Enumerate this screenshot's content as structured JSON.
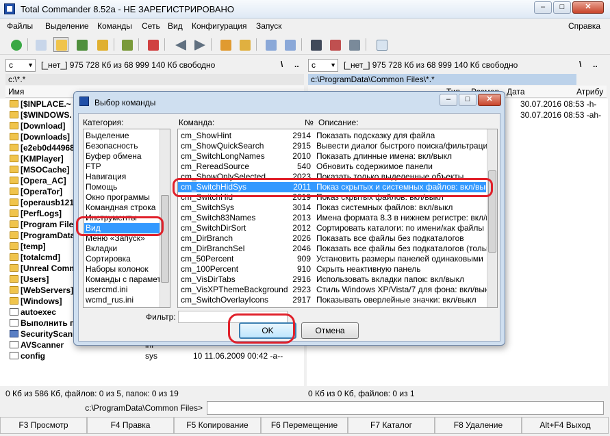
{
  "window": {
    "title": "Total Commander 8.52a - НЕ ЗАРЕГИСТРИРОВАНО",
    "btn_min": "–",
    "btn_max": "□",
    "btn_close": "✕"
  },
  "menu": {
    "items": [
      "Файлы",
      "Выделение",
      "Команды",
      "Сеть",
      "Вид",
      "Конфигурация",
      "Запуск"
    ],
    "help": "Справка"
  },
  "left_panel": {
    "drive": "c",
    "drive_info": "[_нет_]  975 728 Кб из 68 999 140 Кб свободно",
    "root_btn": "\\",
    "up_btn": "..",
    "path": "c:\\*.*",
    "col_name": "Имя",
    "files": [
      {
        "name": "[$INPLACE.~",
        "ext": "",
        "size": "",
        "icon": "folder"
      },
      {
        "name": "[$WINDOWS.",
        "ext": "",
        "size": "",
        "icon": "folder"
      },
      {
        "name": "[Download]",
        "ext": "",
        "size": "",
        "icon": "folder"
      },
      {
        "name": "[Downloads]",
        "ext": "",
        "size": "",
        "icon": "folder"
      },
      {
        "name": "[e2eb0d44968",
        "ext": "",
        "size": "",
        "icon": "folder"
      },
      {
        "name": "[KMPlayer]",
        "ext": "",
        "size": "",
        "icon": "folder"
      },
      {
        "name": "[MSOCache]",
        "ext": "",
        "size": "",
        "icon": "folder"
      },
      {
        "name": "[Opera_AC]",
        "ext": "",
        "size": "",
        "icon": "folder"
      },
      {
        "name": "[OperaTor]",
        "ext": "",
        "size": "",
        "icon": "folder"
      },
      {
        "name": "[operausb121",
        "ext": "",
        "size": "",
        "icon": "folder"
      },
      {
        "name": "[PerfLogs]",
        "ext": "",
        "size": "",
        "icon": "folder"
      },
      {
        "name": "[Program Files",
        "ext": "",
        "size": "",
        "icon": "folder"
      },
      {
        "name": "[ProgramData",
        "ext": "",
        "size": "",
        "icon": "folder"
      },
      {
        "name": "[temp]",
        "ext": "",
        "size": "",
        "icon": "folder"
      },
      {
        "name": "[totalcmd]",
        "ext": "",
        "size": "",
        "icon": "folder"
      },
      {
        "name": "[Unreal Comm",
        "ext": "",
        "size": "",
        "icon": "folder"
      },
      {
        "name": "[Users]",
        "ext": "",
        "size": "",
        "icon": "folder"
      },
      {
        "name": "[WebServers]",
        "ext": "",
        "size": "",
        "icon": "folder"
      },
      {
        "name": "[Windows]",
        "ext": "",
        "size": "",
        "icon": "folder"
      },
      {
        "name": "autoexec",
        "ext": "",
        "size": "",
        "icon": "file"
      },
      {
        "name": "Выполнить п",
        "ext": "",
        "size": "",
        "icon": "file"
      },
      {
        "name": "SecurityScann",
        "ext": "",
        "size": "",
        "icon": "exe"
      },
      {
        "name": "AVScanner",
        "ext": "ini",
        "size": "",
        "icon": "file"
      },
      {
        "name": "config",
        "ext": "sys",
        "size": "10 11.06.2009 00:42 -a--",
        "icon": "file"
      }
    ],
    "status": "0 Кб из 586 Кб, файлов: 0 из 5, папок: 0 из 19"
  },
  "right_panel": {
    "drive": "c",
    "drive_info": "[_нет_]  975 728 Кб из 68 999 140 Кб свободно",
    "root_btn": "\\",
    "up_btn": "..",
    "path": "c:\\ProgramData\\Common Files\\*.*",
    "col_type": "Тип",
    "col_size": "Размер",
    "col_date": "Дата",
    "col_attr": "Атрибу",
    "rows": [
      "30.07.2016 08:53 -h-",
      "30.07.2016 08:53 -ah-"
    ],
    "status": "0 Кб из 0 Кб, файлов: 0 из 1"
  },
  "cmdline": {
    "label": "c:\\ProgramData\\Common Files>",
    "value": ""
  },
  "fkeys": [
    "F3 Просмотр",
    "F4 Правка",
    "F5 Копирование",
    "F6 Перемещение",
    "F7 Каталог",
    "F8 Удаление",
    "Alt+F4 Выход"
  ],
  "dialog": {
    "title": "Выбор команды",
    "category_label": "Категория:",
    "command_label": "Команда:",
    "num_label": "№",
    "desc_label": "Описание:",
    "filter_label": "Фильтр:",
    "filter_value": "",
    "ok": "OK",
    "cancel": "Отмена",
    "categories": [
      "Выделение",
      "Безопасность",
      "Буфер обмена",
      "FTP",
      "Навигация",
      "Помощь",
      "Окно программы",
      "Командная строка",
      "Инструменты",
      "Вид",
      "Меню «Запуск»",
      "Вкладки",
      "Сортировка",
      "Наборы колонок",
      "Команды с параметра",
      "usercmd.ini",
      "wcmd_rus.ini"
    ],
    "selected_category": 9,
    "commands": [
      {
        "name": "cm_ShowHint",
        "num": "2914",
        "desc": "Показать подсказку для файла"
      },
      {
        "name": "cm_ShowQuickSearch",
        "num": "2915",
        "desc": "Вывести диалог быстрого поиска/фильтрации"
      },
      {
        "name": "cm_SwitchLongNames",
        "num": "2010",
        "desc": "Показать длинные имена: вкл/выкл"
      },
      {
        "name": "cm_RereadSource",
        "num": "540",
        "desc": "Обновить содержимое панели"
      },
      {
        "name": "cm_ShowOnlySelected",
        "num": "2023",
        "desc": "Показать только выделенные объекты"
      },
      {
        "name": "cm_SwitchHidSys",
        "num": "2011",
        "desc": "Показ скрытых и системных файлов: вкл/выкл"
      },
      {
        "name": "cm_SwitchHid",
        "num": "2019",
        "desc": "Показ скрытых файлов: вкл/выкл"
      },
      {
        "name": "cm_SwitchSys",
        "num": "3014",
        "desc": "Показ системных файлов: вкл/выкл"
      },
      {
        "name": "cm_Switch83Names",
        "num": "2013",
        "desc": "Имена формата 8.3 в нижнем регистре: вкл/выкл"
      },
      {
        "name": "cm_SwitchDirSort",
        "num": "2012",
        "desc": "Сортировать каталоги: по имени/как файлы"
      },
      {
        "name": "cm_DirBranch",
        "num": "2026",
        "desc": "Показать все файлы без подкаталогов"
      },
      {
        "name": "cm_DirBranchSel",
        "num": "2046",
        "desc": "Показать все файлы без подкаталогов (только в"
      },
      {
        "name": "cm_50Percent",
        "num": "909",
        "desc": "Установить размеры панелей одинаковыми"
      },
      {
        "name": "cm_100Percent",
        "num": "910",
        "desc": "Скрыть неактивную панель"
      },
      {
        "name": "cm_VisDirTabs",
        "num": "2916",
        "desc": "Использовать вкладки папок: вкл/выкл"
      },
      {
        "name": "cm_VisXPThemeBackground",
        "num": "2923",
        "desc": "Стиль Windows XP/Vista/7 для фона: вкл/выкл"
      },
      {
        "name": "cm_SwitchOverlayIcons",
        "num": "2917",
        "desc": "Показывать оверлейные значки: вкл/выкл"
      }
    ],
    "selected_command": 5
  },
  "colors": {
    "selection": "#3399ff",
    "highlight_marker": "#e0202a",
    "path_active": "#bcd2ea"
  }
}
